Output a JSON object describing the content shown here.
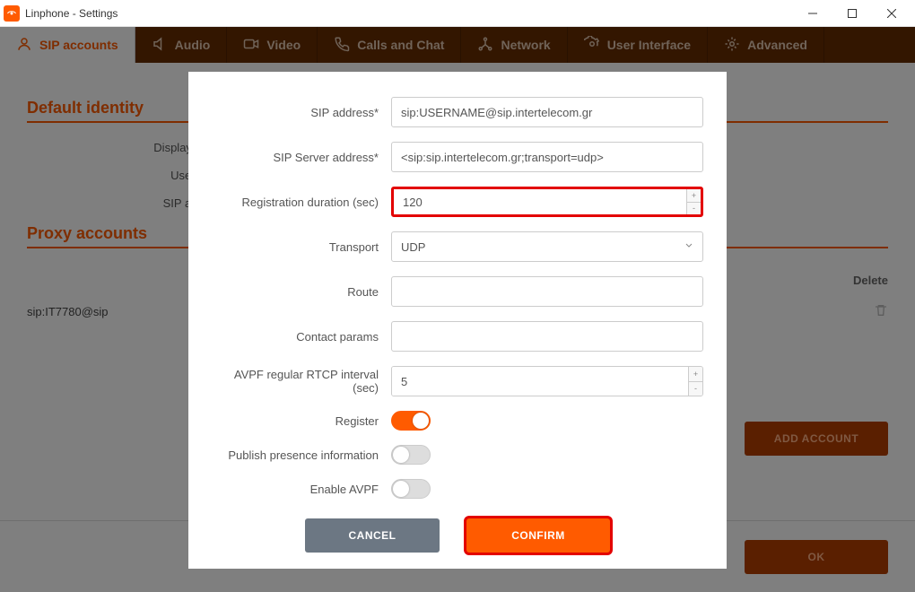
{
  "window": {
    "title": "Linphone - Settings"
  },
  "tabs": {
    "sip": "SIP accounts",
    "audio": "Audio",
    "video": "Video",
    "calls": "Calls and Chat",
    "network": "Network",
    "ui": "User Interface",
    "advanced": "Advanced"
  },
  "sections": {
    "default_identity": "Default identity",
    "proxy_accounts": "Proxy accounts"
  },
  "default_identity": {
    "display_name_label": "Display na",
    "username_label": "Userna",
    "sip_addr_label": "SIP addr"
  },
  "proxy": {
    "delete_header": "Delete",
    "row_address": "sip:IT7780@sip"
  },
  "buttons": {
    "add_account": "ADD ACCOUNT",
    "ok": "OK",
    "cancel": "CANCEL",
    "confirm": "CONFIRM"
  },
  "modal": {
    "sip_address_label": "SIP address*",
    "sip_address_value": "sip:USERNAME@sip.intertelecom.gr",
    "sip_server_label": "SIP Server address*",
    "sip_server_value": "<sip:sip.intertelecom.gr;transport=udp>",
    "reg_duration_label": "Registration duration (sec)",
    "reg_duration_value": "120",
    "transport_label": "Transport",
    "transport_value": "UDP",
    "route_label": "Route",
    "route_value": "",
    "contact_params_label": "Contact params",
    "contact_params_value": "",
    "avpf_interval_label": "AVPF regular RTCP interval (sec)",
    "avpf_interval_value": "5",
    "register_label": "Register",
    "publish_presence_label": "Publish presence information",
    "enable_avpf_label": "Enable AVPF"
  }
}
